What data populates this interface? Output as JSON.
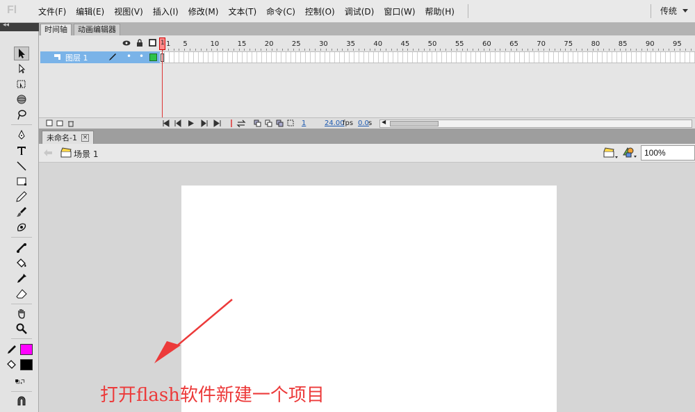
{
  "app": {
    "logo": "Fl"
  },
  "menu": {
    "items": [
      "文件(F)",
      "编辑(E)",
      "视图(V)",
      "插入(I)",
      "修改(M)",
      "文本(T)",
      "命令(C)",
      "控制(O)",
      "调试(D)",
      "窗口(W)",
      "帮助(H)"
    ],
    "workspace": "传统"
  },
  "timeline": {
    "tabs": [
      "时间轴",
      "动画编辑器"
    ],
    "frame_numbers": [
      "1",
      "5",
      "10",
      "15",
      "20",
      "25",
      "30",
      "35",
      "40",
      "45",
      "50",
      "55",
      "60",
      "65",
      "70",
      "75",
      "80",
      "85",
      "90",
      "95"
    ],
    "layer_name": "图层 1",
    "status": {
      "current_frame": "1",
      "fps": "24.00",
      "fps_unit": "fps",
      "time": "0.0",
      "time_unit": "s"
    }
  },
  "document": {
    "tab_title": "未命名-1",
    "close_label": "×",
    "scene_label": "场景 1",
    "zoom": "100%"
  },
  "tools": {
    "stroke_color": "#ff00ff",
    "fill_color": "#000000"
  },
  "annotation": {
    "text": "打开flash软件新建一个项目",
    "color": "#ec3a3a"
  }
}
